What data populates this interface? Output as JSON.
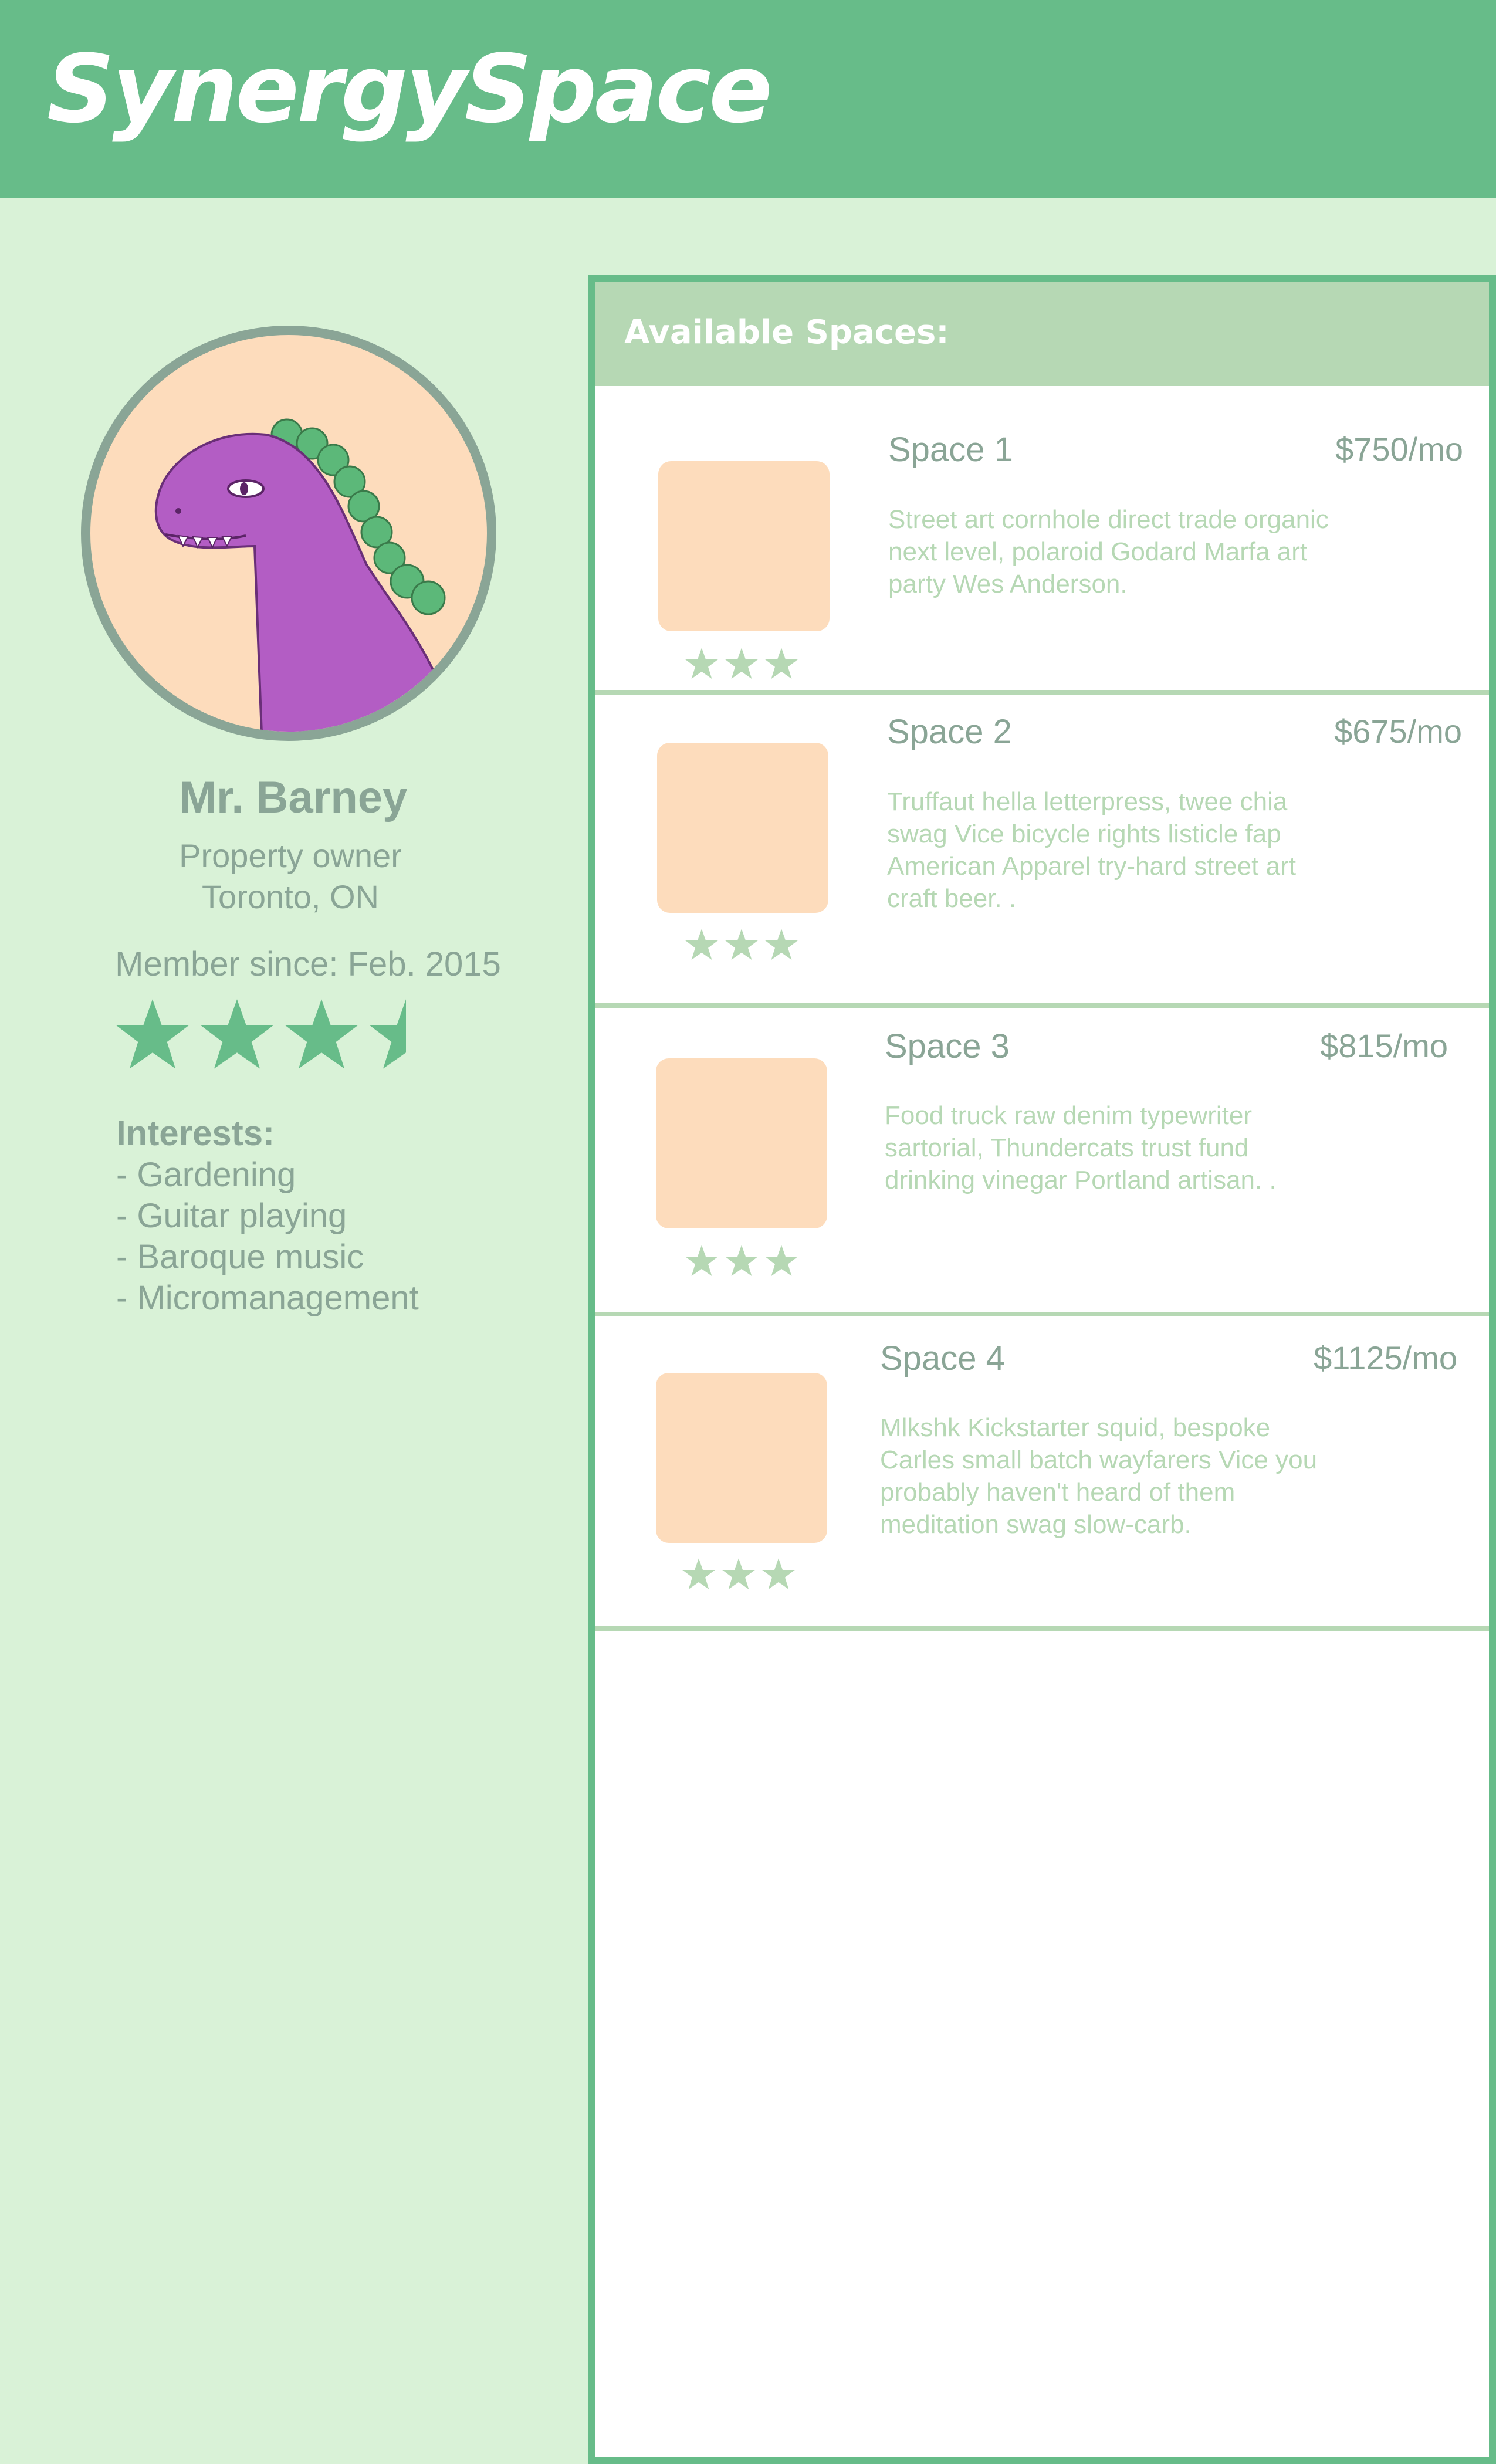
{
  "brand": {
    "name": "SynergySpace"
  },
  "profile": {
    "avatar_icon": "purple-dinosaur-avatar",
    "name": "Mr. Barney",
    "role": "Property owner",
    "location": "Toronto, ON",
    "member_since": "Member since: Feb. 2015",
    "rating": 3.5,
    "rating_max": 5,
    "interests_title": "Interests:",
    "interests": [
      "- Gardening",
      "- Guitar playing",
      "- Baroque music",
      "- Micromanagement"
    ]
  },
  "spaces_panel": {
    "title": "Available Spaces:",
    "spaces": [
      {
        "name": "Space 1",
        "price": "$750/mo",
        "description": "Street art cornhole direct trade organic next level, polaroid Godard Marfa art party Wes Anderson.",
        "rating_stars": 3
      },
      {
        "name": "Space 2",
        "price": "$675/mo",
        "description": "Truffaut hella letterpress, twee chia swag Vice bicycle rights listicle fap American Apparel try-hard street art craft beer. .",
        "rating_stars": 3
      },
      {
        "name": "Space 3",
        "price": "$815/mo",
        "description": "Food truck raw denim typewriter sartorial, Thundercats trust fund drinking vinegar Portland artisan. .",
        "rating_stars": 3
      },
      {
        "name": "Space 4",
        "price": "$1125/mo",
        "description": "Mlkshk Kickstarter squid, bespoke Carles small batch wayfarers Vice you probably haven't heard of them meditation swag slow-carb.",
        "rating_stars": 3
      }
    ]
  },
  "colors": {
    "header": "#67bc89",
    "background": "#d9f2d7",
    "panel_header": "#b6d8b4",
    "text": "#8aa596",
    "thumbnail": "#fddcbc",
    "avatar_dino": "#b35dc4"
  }
}
